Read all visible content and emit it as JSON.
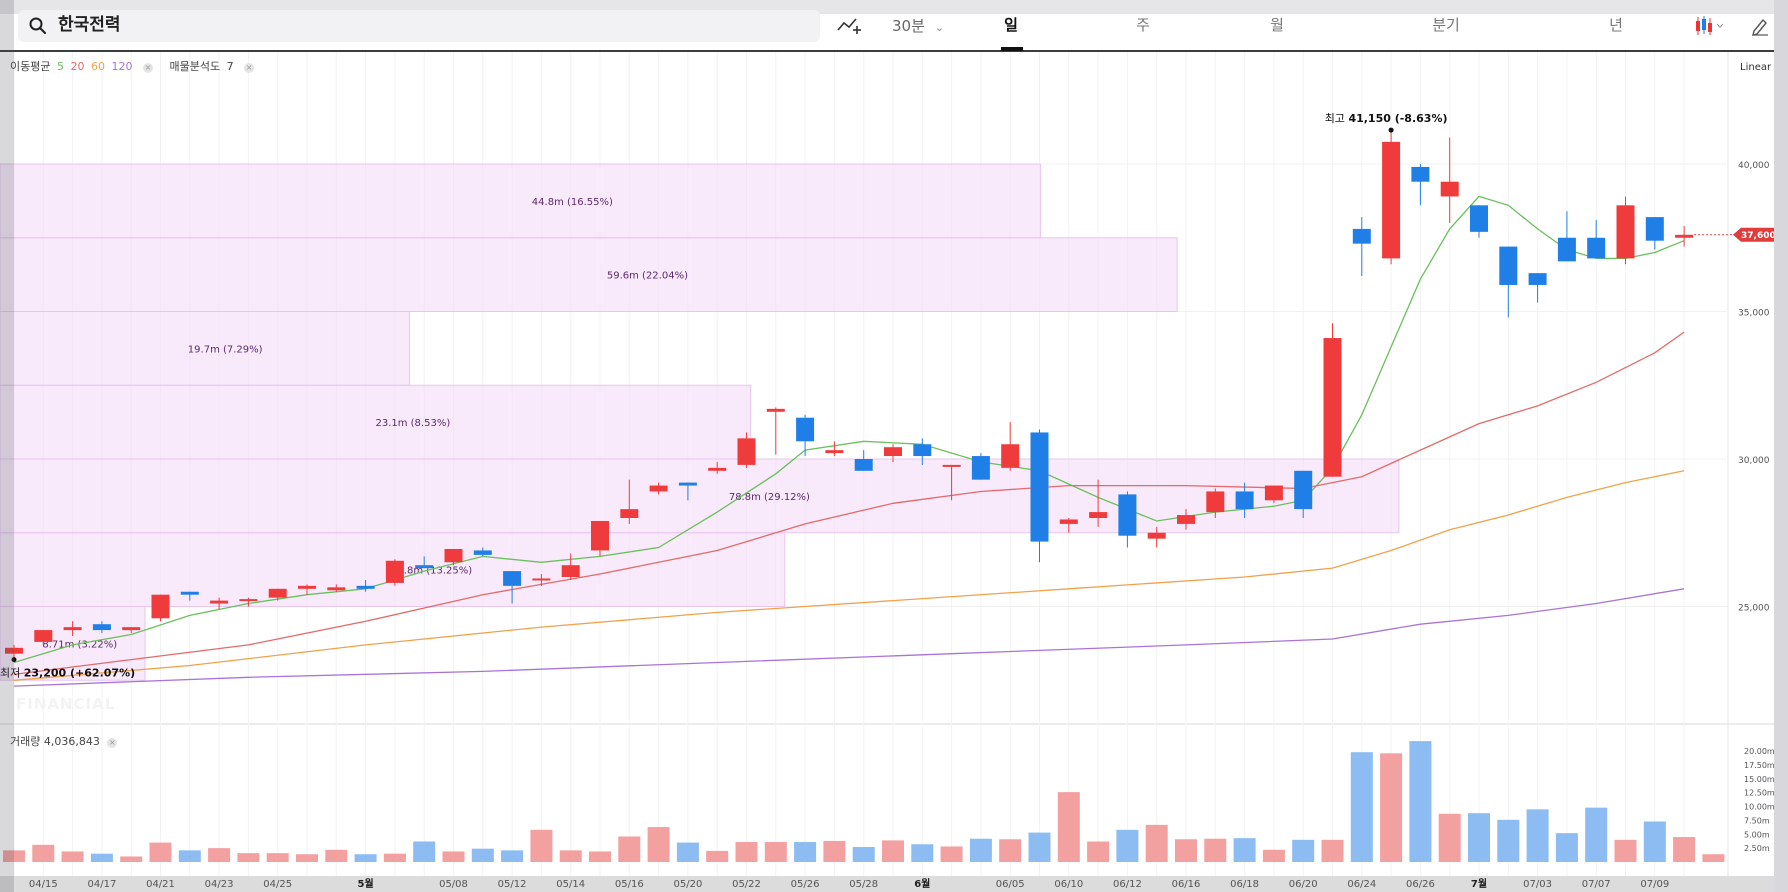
{
  "toolbar": {
    "search_value": "한국전력",
    "interval_label": "30분",
    "tabs": [
      {
        "label": "일",
        "active": true
      },
      {
        "label": "주",
        "active": false
      },
      {
        "label": "월",
        "active": false
      },
      {
        "label": "분기",
        "active": false
      },
      {
        "label": "년",
        "active": false
      }
    ],
    "icons": [
      "search-icon",
      "add-indicator-icon",
      "chevron-down-icon",
      "candlestick-icon",
      "pencil-icon"
    ]
  },
  "legend": {
    "ma_label": "이동평균",
    "ma_periods": [
      "5",
      "20",
      "60",
      "120"
    ],
    "ma_colors": [
      "#6ac05c",
      "#e36a6a",
      "#f0a24a",
      "#a974d8"
    ],
    "profile_label": "매물분석도",
    "profile_value": "7",
    "volume_label": "거래량",
    "volume_value": "4,036,843"
  },
  "scale_label": "Linear",
  "colors": {
    "up": "#ef3b3b",
    "down": "#1f7fe6",
    "vol_up": "#f3a0a0",
    "vol_down": "#8cbcf2",
    "profile": "#f3dcf8",
    "last_price_tag": "#e03c3c"
  },
  "chart_data": {
    "type": "candlestick",
    "y_axis": {
      "min": 22000,
      "max": 42000,
      "ticks": [
        25000,
        30000,
        35000,
        40000
      ],
      "tick_labels": [
        "25,000",
        "30,000",
        "35,000",
        "40,000"
      ]
    },
    "x_tick_labels": [
      {
        "label": "04/15",
        "index": 1
      },
      {
        "label": "04/17",
        "index": 3
      },
      {
        "label": "04/21",
        "index": 5
      },
      {
        "label": "04/23",
        "index": 7
      },
      {
        "label": "04/25",
        "index": 9
      },
      {
        "label": "5월",
        "index": 12
      },
      {
        "label": "05/08",
        "index": 15
      },
      {
        "label": "05/12",
        "index": 17
      },
      {
        "label": "05/14",
        "index": 19
      },
      {
        "label": "05/16",
        "index": 21
      },
      {
        "label": "05/20",
        "index": 23
      },
      {
        "label": "05/22",
        "index": 25
      },
      {
        "label": "05/26",
        "index": 27
      },
      {
        "label": "05/28",
        "index": 29
      },
      {
        "label": "6월",
        "index": 31
      },
      {
        "label": "06/05",
        "index": 34
      },
      {
        "label": "06/10",
        "index": 36
      },
      {
        "label": "06/12",
        "index": 38
      },
      {
        "label": "06/16",
        "index": 40
      },
      {
        "label": "06/18",
        "index": 42
      },
      {
        "label": "06/20",
        "index": 44
      },
      {
        "label": "06/24",
        "index": 46
      },
      {
        "label": "06/26",
        "index": 48
      },
      {
        "label": "7월",
        "index": 50
      },
      {
        "label": "07/03",
        "index": 52
      },
      {
        "label": "07/07",
        "index": 54
      },
      {
        "label": "07/09",
        "index": 56
      }
    ],
    "candles": [
      {
        "o": 23400,
        "h": 23700,
        "l": 23200,
        "c": 23600
      },
      {
        "o": 23800,
        "h": 24200,
        "l": 23700,
        "c": 24200
      },
      {
        "o": 24200,
        "h": 24500,
        "l": 24000,
        "c": 24300
      },
      {
        "o": 24400,
        "h": 24500,
        "l": 24100,
        "c": 24200
      },
      {
        "o": 24200,
        "h": 24300,
        "l": 24100,
        "c": 24300
      },
      {
        "o": 24600,
        "h": 25400,
        "l": 24500,
        "c": 25400
      },
      {
        "o": 25500,
        "h": 25500,
        "l": 25200,
        "c": 25400
      },
      {
        "o": 25100,
        "h": 25300,
        "l": 24900,
        "c": 25200
      },
      {
        "o": 25200,
        "h": 25300,
        "l": 25000,
        "c": 25250
      },
      {
        "o": 25300,
        "h": 25600,
        "l": 25200,
        "c": 25600
      },
      {
        "o": 25600,
        "h": 25750,
        "l": 25400,
        "c": 25700
      },
      {
        "o": 25550,
        "h": 25750,
        "l": 25500,
        "c": 25650
      },
      {
        "o": 25700,
        "h": 25900,
        "l": 25500,
        "c": 25600
      },
      {
        "o": 25800,
        "h": 26600,
        "l": 25700,
        "c": 26550
      },
      {
        "o": 26400,
        "h": 26700,
        "l": 26300,
        "c": 26300
      },
      {
        "o": 26500,
        "h": 26900,
        "l": 26400,
        "c": 26950
      },
      {
        "o": 26900,
        "h": 27000,
        "l": 26700,
        "c": 26750
      },
      {
        "o": 26200,
        "h": 26200,
        "l": 25100,
        "c": 25700
      },
      {
        "o": 25900,
        "h": 26100,
        "l": 25700,
        "c": 25950
      },
      {
        "o": 26000,
        "h": 26800,
        "l": 25900,
        "c": 26400
      },
      {
        "o": 26900,
        "h": 27900,
        "l": 26700,
        "c": 27900
      },
      {
        "o": 28000,
        "h": 29300,
        "l": 27800,
        "c": 28300
      },
      {
        "o": 28900,
        "h": 29200,
        "l": 28800,
        "c": 29100
      },
      {
        "o": 29200,
        "h": 29200,
        "l": 28600,
        "c": 29100
      },
      {
        "o": 29600,
        "h": 29900,
        "l": 29500,
        "c": 29700
      },
      {
        "o": 29800,
        "h": 30900,
        "l": 29700,
        "c": 30700
      },
      {
        "o": 31600,
        "h": 31750,
        "l": 30150,
        "c": 31700
      },
      {
        "o": 31400,
        "h": 31500,
        "l": 30100,
        "c": 30600
      },
      {
        "o": 30200,
        "h": 30600,
        "l": 30100,
        "c": 30300
      },
      {
        "o": 30000,
        "h": 30300,
        "l": 29600,
        "c": 29600
      },
      {
        "o": 30100,
        "h": 30500,
        "l": 29900,
        "c": 30400
      },
      {
        "o": 30500,
        "h": 30700,
        "l": 29800,
        "c": 30100
      },
      {
        "o": 29800,
        "h": 29800,
        "l": 28600,
        "c": 29800
      },
      {
        "o": 30100,
        "h": 30200,
        "l": 29300,
        "c": 29300
      },
      {
        "o": 29700,
        "h": 31250,
        "l": 29600,
        "c": 30500
      },
      {
        "o": 30900,
        "h": 31000,
        "l": 26500,
        "c": 27200
      },
      {
        "o": 27800,
        "h": 28000,
        "l": 27500,
        "c": 27950
      },
      {
        "o": 28000,
        "h": 29300,
        "l": 27700,
        "c": 28200
      },
      {
        "o": 28800,
        "h": 28900,
        "l": 27000,
        "c": 27400
      },
      {
        "o": 27300,
        "h": 27700,
        "l": 27000,
        "c": 27500
      },
      {
        "o": 27800,
        "h": 28300,
        "l": 27600,
        "c": 28100
      },
      {
        "o": 28200,
        "h": 29000,
        "l": 28000,
        "c": 28900
      },
      {
        "o": 28900,
        "h": 29200,
        "l": 28000,
        "c": 28300
      },
      {
        "o": 28600,
        "h": 29000,
        "l": 28500,
        "c": 29100
      },
      {
        "o": 29600,
        "h": 29600,
        "l": 28000,
        "c": 28300
      },
      {
        "o": 29400,
        "h": 34600,
        "l": 29400,
        "c": 34100
      },
      {
        "o": 37800,
        "h": 38200,
        "l": 36200,
        "c": 37300
      },
      {
        "o": 36800,
        "h": 41150,
        "l": 36600,
        "c": 40750
      },
      {
        "o": 39900,
        "h": 40000,
        "l": 38600,
        "c": 39400
      },
      {
        "o": 38900,
        "h": 40900,
        "l": 38000,
        "c": 39400
      },
      {
        "o": 38600,
        "h": 38600,
        "l": 37500,
        "c": 37700
      },
      {
        "o": 37200,
        "h": 37200,
        "l": 34800,
        "c": 35900
      },
      {
        "o": 36300,
        "h": 36300,
        "l": 35300,
        "c": 35900
      },
      {
        "o": 37500,
        "h": 38400,
        "l": 36800,
        "c": 36700
      },
      {
        "o": 37500,
        "h": 38100,
        "l": 36900,
        "c": 36800
      },
      {
        "o": 36800,
        "h": 38900,
        "l": 36600,
        "c": 38600
      },
      {
        "o": 38200,
        "h": 38200,
        "l": 37100,
        "c": 37400
      },
      {
        "o": 37500,
        "h": 37900,
        "l": 37200,
        "c": 37600
      }
    ],
    "moving_averages": [
      {
        "period": 5,
        "points": [
          [
            0,
            23100
          ],
          [
            2,
            23700
          ],
          [
            4,
            24050
          ],
          [
            6,
            24700
          ],
          [
            8,
            25100
          ],
          [
            10,
            25400
          ],
          [
            12,
            25600
          ],
          [
            14,
            26200
          ],
          [
            16,
            26700
          ],
          [
            18,
            26500
          ],
          [
            20,
            26700
          ],
          [
            22,
            27000
          ],
          [
            24,
            28200
          ],
          [
            26,
            29500
          ],
          [
            27,
            30300
          ],
          [
            29,
            30600
          ],
          [
            31,
            30500
          ],
          [
            33,
            29900
          ],
          [
            35,
            29600
          ],
          [
            37,
            28700
          ],
          [
            39,
            27900
          ],
          [
            41,
            28200
          ],
          [
            43,
            28400
          ],
          [
            44,
            28600
          ],
          [
            45,
            29700
          ],
          [
            46,
            31500
          ],
          [
            47,
            33800
          ],
          [
            48,
            36100
          ],
          [
            49,
            37800
          ],
          [
            50,
            38900
          ],
          [
            51,
            38600
          ],
          [
            52,
            37800
          ],
          [
            53,
            37100
          ],
          [
            54,
            36800
          ],
          [
            55,
            36800
          ],
          [
            56,
            37000
          ],
          [
            57,
            37400
          ]
        ]
      },
      {
        "period": 20,
        "points": [
          [
            0,
            22700
          ],
          [
            4,
            23200
          ],
          [
            8,
            23700
          ],
          [
            12,
            24500
          ],
          [
            16,
            25400
          ],
          [
            20,
            26100
          ],
          [
            24,
            26900
          ],
          [
            27,
            27800
          ],
          [
            30,
            28500
          ],
          [
            33,
            28900
          ],
          [
            36,
            29100
          ],
          [
            40,
            29100
          ],
          [
            44,
            29000
          ],
          [
            46,
            29400
          ],
          [
            48,
            30300
          ],
          [
            50,
            31200
          ],
          [
            52,
            31800
          ],
          [
            54,
            32600
          ],
          [
            56,
            33600
          ],
          [
            57,
            34300
          ]
        ]
      },
      {
        "period": 60,
        "points": [
          [
            0,
            22500
          ],
          [
            6,
            23000
          ],
          [
            12,
            23700
          ],
          [
            18,
            24300
          ],
          [
            24,
            24800
          ],
          [
            30,
            25200
          ],
          [
            36,
            25600
          ],
          [
            42,
            26000
          ],
          [
            45,
            26300
          ],
          [
            47,
            26900
          ],
          [
            49,
            27600
          ],
          [
            51,
            28100
          ],
          [
            53,
            28700
          ],
          [
            55,
            29200
          ],
          [
            57,
            29600
          ]
        ]
      },
      {
        "period": 120,
        "points": [
          [
            0,
            22300
          ],
          [
            8,
            22600
          ],
          [
            16,
            22800
          ],
          [
            24,
            23100
          ],
          [
            32,
            23400
          ],
          [
            40,
            23700
          ],
          [
            45,
            23900
          ],
          [
            48,
            24400
          ],
          [
            51,
            24700
          ],
          [
            54,
            25100
          ],
          [
            57,
            25600
          ]
        ]
      }
    ],
    "volume_profile": [
      {
        "low": 22500,
        "high": 25000,
        "label": "8.71m (3.22%)",
        "extent": 0.085
      },
      {
        "low": 25000,
        "high": 27500,
        "label": "35.8m (13.25%)",
        "extent": 0.46
      },
      {
        "low": 27500,
        "high": 30000,
        "label": "78.8m (29.12%)",
        "extent": 0.82
      },
      {
        "low": 30000,
        "high": 32500,
        "label": "23.1m (8.53%)",
        "extent": 0.44
      },
      {
        "low": 32500,
        "high": 35000,
        "label": "19.7m (7.29%)",
        "extent": 0.24
      },
      {
        "low": 35000,
        "high": 37500,
        "label": "59.6m (22.04%)",
        "extent": 0.69
      },
      {
        "low": 37500,
        "high": 40000,
        "label": "44.8m (16.55%)",
        "extent": 0.61
      }
    ],
    "high_marker": {
      "label_prefix": "최고",
      "value": "41,150",
      "change": "(-8.63%)",
      "index": 47,
      "price": 41150
    },
    "low_marker": {
      "label_prefix": "최저",
      "value": "23,200",
      "change": "(+62.07%)",
      "index": 0,
      "price": 23200
    },
    "last_price": {
      "value": 37600,
      "label": "37,600"
    },
    "volume": {
      "max": 22000000,
      "tick_labels": [
        "2.50m",
        "5.00m",
        "7.50m",
        "10.00m",
        "12.50m",
        "15.00m",
        "17.50m",
        "20.00m"
      ],
      "ticks": [
        2500000,
        5000000,
        7500000,
        10000000,
        12500000,
        15000000,
        17500000,
        20000000
      ],
      "values": [
        2100000,
        3100000,
        1900000,
        1500000,
        1000000,
        3500000,
        2100000,
        2500000,
        1600000,
        1600000,
        1400000,
        2200000,
        1400000,
        1500000,
        3700000,
        1900000,
        2400000,
        2100000,
        5800000,
        2100000,
        1900000,
        4600000,
        6300000,
        3500000,
        2000000,
        3600000,
        3600000,
        3600000,
        3800000,
        2700000,
        3900000,
        3200000,
        2800000,
        4200000,
        4100000,
        5300000,
        12600000,
        3700000,
        5800000,
        6700000,
        4100000,
        4200000,
        4300000,
        2200000,
        4000000,
        4000000,
        19800000,
        19600000,
        21800000,
        8700000,
        8800000,
        7600000,
        9500000,
        5200000,
        9800000,
        4000000,
        7300000,
        4500000,
        1400000
      ]
    }
  }
}
